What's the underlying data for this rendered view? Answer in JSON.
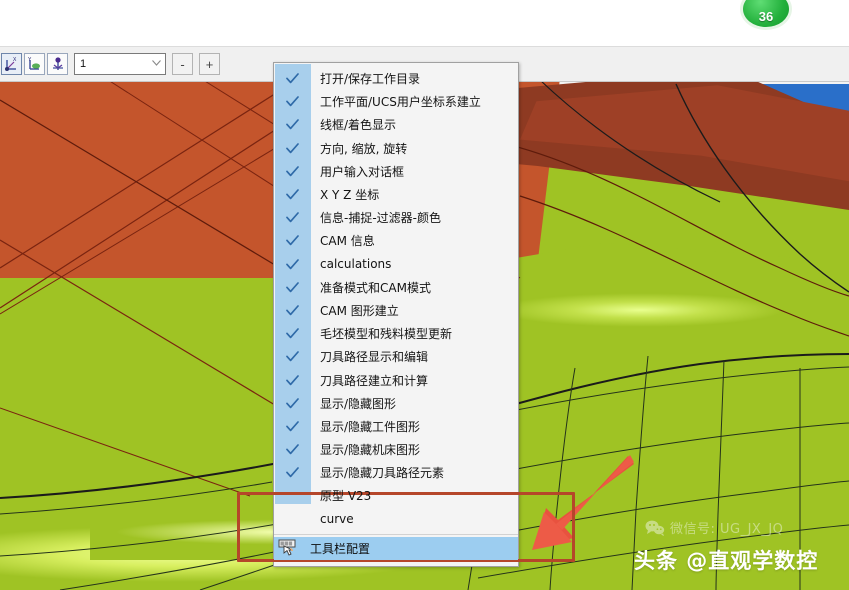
{
  "toolbar": {
    "buttons": [
      {
        "name": "xyz-axis-1-button",
        "icon": "xyz-axis-icon"
      },
      {
        "name": "xyz-axis-2-button",
        "icon": "yz-axis-icon"
      },
      {
        "name": "xyz-axis-3-button",
        "icon": "origin-axis-icon"
      }
    ],
    "combo_value": "1",
    "combo_placeholder": "1",
    "minus_label": "-",
    "plus_label": "+"
  },
  "menu": {
    "items": [
      {
        "label": "打开/保存工作目录",
        "checked": true
      },
      {
        "label": "工作平面/UCS用户坐标系建立",
        "checked": true
      },
      {
        "label": "线框/着色显示",
        "checked": true
      },
      {
        "label": "方向, 缩放, 旋转",
        "checked": true
      },
      {
        "label": "用户输入对话框",
        "checked": true
      },
      {
        "label": "X Y Z 坐标",
        "checked": true
      },
      {
        "label": "信息-捕捉-过滤器-颜色",
        "checked": true
      },
      {
        "label": "CAM 信息",
        "checked": true
      },
      {
        "label": "calculations",
        "checked": true
      },
      {
        "label": "准备模式和CAM模式",
        "checked": true
      },
      {
        "label": "CAM 图形建立",
        "checked": true
      },
      {
        "label": "毛坯模型和残料模型更新",
        "checked": true
      },
      {
        "label": "刀具路径显示和编辑",
        "checked": true
      },
      {
        "label": "刀具路径建立和计算",
        "checked": true
      },
      {
        "label": "显示/隐藏图形",
        "checked": true
      },
      {
        "label": "显示/隐藏工件图形",
        "checked": true
      },
      {
        "label": "显示/隐藏机床图形",
        "checked": true
      },
      {
        "label": "显示/隐藏刀具路径元素",
        "checked": true
      },
      {
        "label": "原型 V23",
        "checked": false
      },
      {
        "label": "curve",
        "checked": false
      }
    ],
    "config_item": {
      "label": "工具栏配置",
      "icon": "toolbar-config-icon",
      "selected": true
    }
  },
  "badge": {
    "count": "36"
  },
  "watermarks": {
    "wechat": "微信号: UG_JX_JQ",
    "toutiao": "头条 @直观学数控",
    "wechat_icon": "wechat-icon",
    "toutiao_icon": "at-sign-icon"
  },
  "colors": {
    "surface_orange": "#C4552C",
    "surface_dark_red": "#8E3A22",
    "surface_green": "#9FC324",
    "surface_blue": "#2A6FC9",
    "highlight_rect": "#B5462A",
    "arrow": "#E8523F",
    "menu_check_col": "#A8CFEC",
    "menu_selected": "#9CCDF0",
    "badge_green": "#23B03C"
  },
  "annotations": {
    "arrow": "red-pointer-arrow",
    "highlight": "red-highlight-rectangle"
  }
}
